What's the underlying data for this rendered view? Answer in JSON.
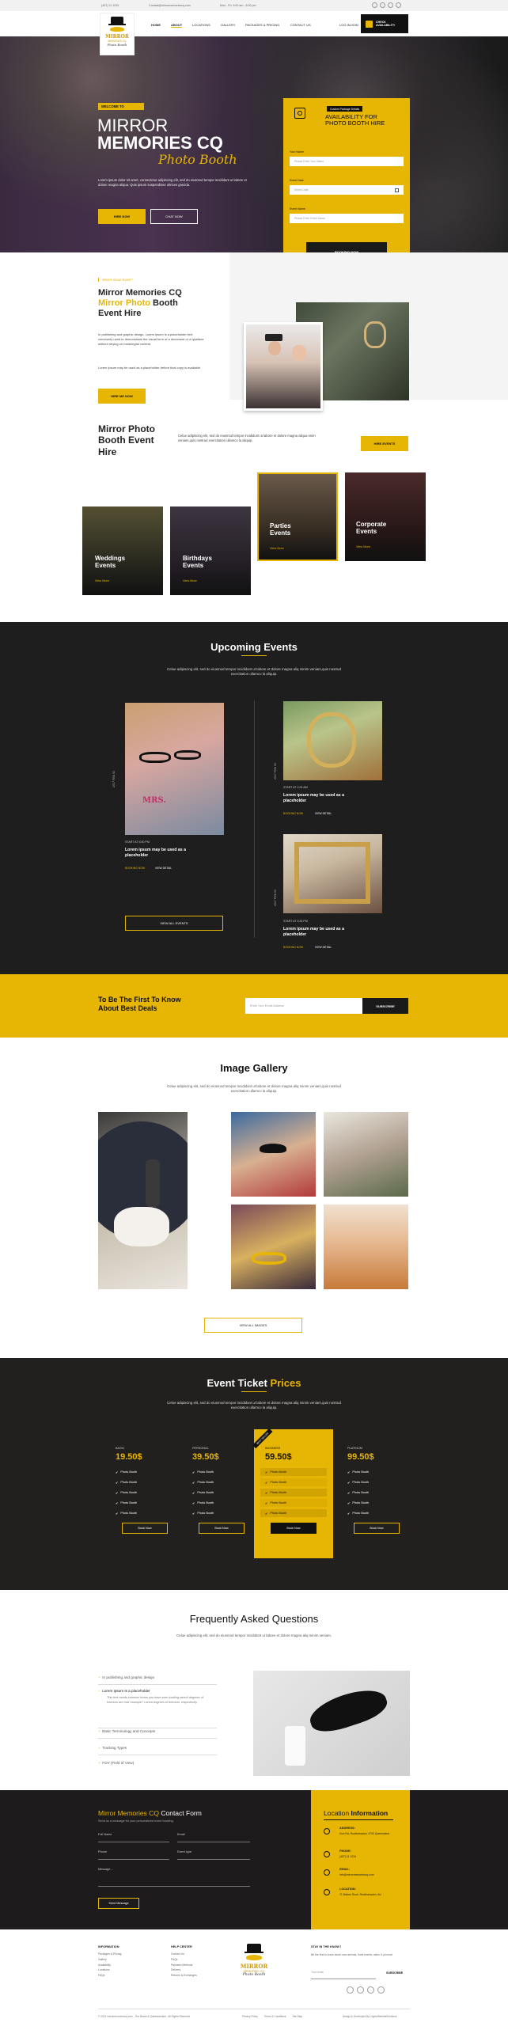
{
  "topbar": {
    "phone": "(407) 11 1234",
    "email": "Contact@mirrormemoriescq.com",
    "hours": "Mon - Fri: 9:00 am - 6:00 pm"
  },
  "nav": {
    "logo_text": "MIRROR",
    "logo_sub": "MEMORIES CQ",
    "logo_script": "Photo Booth",
    "items": [
      "HOME",
      "ABOUT",
      "LOCATIONS",
      "GALLERY",
      "PACKAGES & PRICING",
      "CONTACT US"
    ],
    "login": "LOG IN/JOIN",
    "cta_line1": "CHECK",
    "cta_line2": "AVAILABILITY"
  },
  "hero": {
    "tag": "WELCOME TO",
    "title1": "MIRROR",
    "title2": "MEMORIES CQ",
    "script": "Photo Booth",
    "desc": "Lorem ipsum dolor sit amet, consectetur adipiscing elit, sed do eiusmod tempor incididunt ut labore et dolore magna aliqua. Quis ipsum suspendisse ultrices gravida.",
    "btn1": "HIRE NOW",
    "btn2": "CHAT NOW"
  },
  "availability": {
    "badge": "Custom Package Details",
    "title1": "AVAILABILITY FOR",
    "title2": "PHOTO BOOTH HIRE",
    "f1_label": "Your Name",
    "f1_ph": "Please Enter Your Name",
    "f2_label": "Event Date",
    "f2_ph": "Select Date",
    "f3_label": "Event Name",
    "f3_ph": "Please Enter Event Name",
    "submit": "BOOKING NOW"
  },
  "about": {
    "tag": "What's About Event?",
    "title1": "Mirror Memories CQ",
    "title2_y": "Mirror Photo",
    "title2_b": " Booth",
    "title3": "Event Hire",
    "p1": "In publishing and graphic design, Lorem ipsum is a placeholder text commonly used to demonstrate the visual form of a document or a typeface without relying on meaningful content.",
    "p2": "Lorem ipsum may be used as a placeholder before final copy is available.",
    "btn": "HIRE ME NOW"
  },
  "events": {
    "title1": "Mirror Photo",
    "title2": "Booth Event",
    "title3": "Hire",
    "desc": "Celue adipiscing elit, sed do eiusmod tempor incididunt ut labore et dolore magna aliqua enim veniam,quis nostrud exercitation ullamco la aliquip.",
    "btn": "HIRE EVENTS",
    "cards": [
      {
        "l1": "Weddings",
        "l2": "Events",
        "link": "View More"
      },
      {
        "l1": "Birthdays",
        "l2": "Events",
        "link": "View More"
      },
      {
        "l1": "Parties",
        "l2": "Events",
        "link": "View More"
      },
      {
        "l1": "Corporate",
        "l2": "Events",
        "link": "View More"
      }
    ]
  },
  "upcoming": {
    "title": "Upcoming Events",
    "sub": "Celue adipiscing elit, sed do eiusmod tempor incididunt ut labore et dolore magna aliq minim veniam,quis nostrud exercitation ullamco la aliquip.",
    "side_date": "2017 FEB 03",
    "items": [
      {
        "start": "START AT 6:00 PM",
        "title": "Lorem ipsum may be used as a placeholder",
        "book": "BOOKING NOW",
        "detail": "VIEW DETAIL"
      },
      {
        "start": "START AT 2:00 AM",
        "title": "Lorem ipsum may be used as a placeholder",
        "book": "BOOKING NOW",
        "detail": "VIEW DETAIL"
      },
      {
        "start": "START AT 5:30 PM",
        "title": "Lorem ipsum may be used as a placeholder",
        "book": "BOOKING NOW",
        "detail": "VIEW DETAIL"
      }
    ],
    "btn": "VIEW ALL EVENTS"
  },
  "newsletter": {
    "line1": "To Be The First To Know",
    "line2": "About Best Deals",
    "ph": "Enter Your Email Address",
    "btn": "SUBSCRIBE"
  },
  "gallery": {
    "title": "Image Gallery",
    "sub": "Celue adipiscing elit, sed do eiusmod tempor incididunt ut labore et dolore magna aliq minim veniam,quis nostrud exercitation ullamco la aliquip.",
    "btn": "VIEW ALL IMAGES"
  },
  "pricing": {
    "title1": "Event Ticket ",
    "title2": "Prices",
    "sub": "Celue adipiscing elit, sed do eiusmod tempor incididunt ut labore et dolore magna aliq minim veniam,quis nostrud exercitation ullamco la aliquip.",
    "ribbon": "BEST SELLER",
    "plans": [
      {
        "name": "BASIC",
        "price": "19.50$",
        "btn": "Book Now",
        "features": [
          "Photo Booth",
          "Photo Booth",
          "Photo Booth",
          "Photo Booth",
          "Photo Booth"
        ]
      },
      {
        "name": "PERSONAL",
        "price": "39.50$",
        "btn": "Book Now",
        "features": [
          "Photo Booth",
          "Photo Booth",
          "Photo Booth",
          "Photo Booth",
          "Photo Booth"
        ]
      },
      {
        "name": "BUSINESS",
        "price": "59.50$",
        "btn": "Book Now",
        "features": [
          "Photo Booth",
          "Photo Booth",
          "Photo Booth",
          "Photo Booth",
          "Photo Booth"
        ]
      },
      {
        "name": "PLATINUM",
        "price": "99.50$",
        "btn": "Book Now",
        "features": [
          "Photo Booth",
          "Photo Booth",
          "Photo Booth",
          "Photo Booth",
          "Photo Booth"
        ]
      }
    ]
  },
  "faq": {
    "title": "Frequently Asked Questions",
    "sub": "Celue adipiscing elit, sed do eiusmod tempor incididunt ut labore et dolore magna aliq minim veniam.",
    "items": [
      {
        "q": "In publishing and graphic design"
      },
      {
        "q": "Lorem Ipsum Is a placeholder",
        "a": "This text needs common terms you have seen loading stencil degrees of freedom are that' example? Lorem degrees of freedom, respectively."
      },
      {
        "q": "Basic Terminology and Concepts"
      },
      {
        "q": "Tracking Types"
      },
      {
        "q": "FOV (Field of View)"
      }
    ]
  },
  "contact": {
    "title_y": "Mirror Memories CQ",
    "title_w": " Contact Form",
    "sub": "Send us a message for your personalized event booking.",
    "f_name": "Full Name",
    "f_email": "Email",
    "f_phone": "Phone",
    "f_event": "Event type",
    "f_msg": "Message...",
    "btn": "Send Message",
    "loc_title1": "Location ",
    "loc_title2": "Information",
    "address_t": "ADDRESS:",
    "address": "Gun Rd, Rockhampton, 4700 Queensland",
    "phone_t": "PHONE:",
    "phone": "(407) 11 1234",
    "email_t": "EMAIL:",
    "email": "info@mirrormemoriescq.com",
    "location_t": "LOCATION:",
    "location": "71 Balcon Rock, Rockhampton, AU"
  },
  "footer": {
    "col1_t": "INFORMATION",
    "col1": [
      "Packages & Pricing",
      "Gallery",
      "Availability",
      "Locations",
      "FAQs"
    ],
    "col2_t": "HELP CENTER",
    "col2": [
      "Contact Us",
      "FAQs",
      "Payment Methods",
      "Delivery",
      "Returns & Exchanges"
    ],
    "col4_t": "STAY IN THE KNOW !",
    "col4_p": "Be the first to know about new arrivals, local events, sales & promos!",
    "col4_ph": "Your email",
    "col4_btn": "SUBSCRIBE",
    "copy": "© 2021 mirrormemoriescq.com - The Brand & Quintessential - All Rights Reserved",
    "links": [
      "Privacy Policy",
      "Terms & Conditions",
      "Site Map"
    ],
    "credit": "Design & Developed By CryptoWebsiteSolutions"
  }
}
